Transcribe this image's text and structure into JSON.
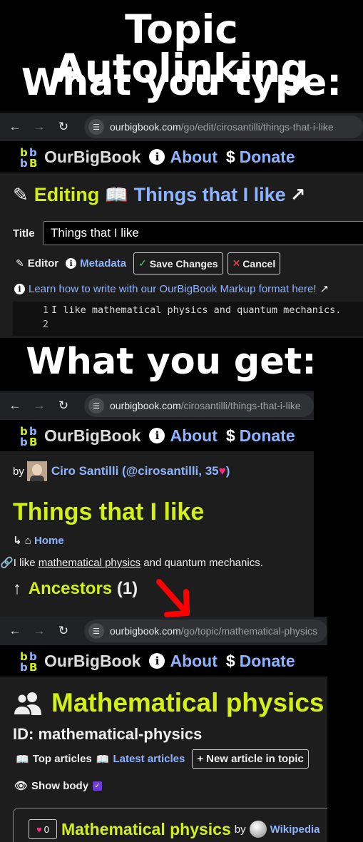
{
  "headings": {
    "line1": "Topic Autolinking",
    "line2": "What you type:",
    "line3": "What you get:"
  },
  "site": {
    "brand": "OurBigBook",
    "about": "About",
    "donate": "Donate"
  },
  "editor_panel": {
    "url_host": "ourbigbook.com",
    "url_path": "/go/edit/cirosantilli/things-that-i-like",
    "editing_label": "Editing",
    "article_title": "Things that I like",
    "title_label": "Title",
    "title_value": "Things that I like",
    "editor_tab": "Editor",
    "metadata_tab": "Metadata",
    "save_button": "Save Changes",
    "cancel_button": "Cancel",
    "learn_link": "Learn how to write with our OurBigBook Markup format here!",
    "code_lines": [
      {
        "num": "1",
        "text": "I like mathematical physics and quantum mechanics."
      },
      {
        "num": "2",
        "text": ""
      }
    ]
  },
  "article_panel": {
    "url_host": "ourbigbook.com",
    "url_path": "/cirosantilli/things-that-i-like",
    "by_label": "by",
    "author": "Ciro Santilli (@cirosantilli, 35",
    "author_close": ")",
    "title": "Things that I like",
    "home_link": "Home",
    "body_pre": "I like ",
    "body_link": "mathematical physics",
    "body_post": " and quantum mechanics.",
    "ancestors_label": "Ancestors",
    "ancestors_count": "(1)"
  },
  "topic_panel": {
    "url_host": "ourbigbook.com",
    "url_path": "/go/topic/mathematical-physics",
    "title": "Mathematical physics",
    "id_line": "ID: mathematical-physics",
    "top_articles": "Top articles",
    "latest_articles": "Latest articles",
    "new_article_button": "New article in topic",
    "show_body": "Show body",
    "card_likes": "0",
    "card_title": "Mathematical physics",
    "card_by": "by",
    "card_author": "Wikipedia"
  },
  "colors": {
    "lime": "#d2f016",
    "link_blue": "#8fb4ff",
    "heart_pink": "#ff2d82",
    "arrow_red": "#ff0000"
  }
}
